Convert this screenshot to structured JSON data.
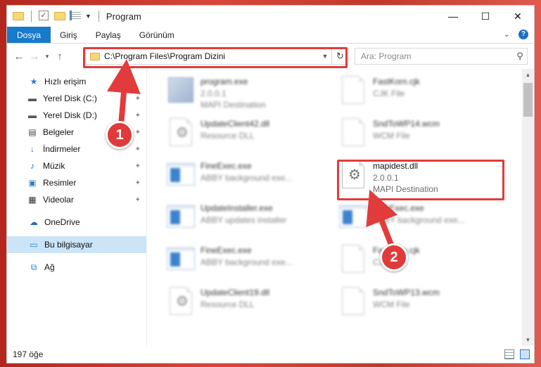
{
  "window": {
    "title": "Program",
    "controls": {
      "minimize": "—",
      "maximize": "☐",
      "close": "✕"
    }
  },
  "ribbon": {
    "tabs": [
      "Dosya",
      "Giriş",
      "Paylaş",
      "Görünüm"
    ],
    "expand_icon": "chevron-down-icon",
    "help_label": "?"
  },
  "address": {
    "path": "C:\\Program Files\\Program Dizini",
    "search_placeholder": "Ara: Program"
  },
  "sidebar": {
    "quick_access": "Hızlı erişim",
    "pinned": [
      "Yerel Disk (C:)",
      "Yerel Disk (D:)",
      "Belgeler",
      "İndirmeler",
      "Müzik",
      "Resimler",
      "Videolar"
    ],
    "onedrive": "OneDrive",
    "this_pc": "Bu bilgisayar",
    "network": "Ağ"
  },
  "files": {
    "left": [
      {
        "name": "program.exe",
        "line2": "2.0.0.1",
        "line3": "MAPI Destination",
        "icon": "exe-icon"
      },
      {
        "name": "UpdateClient42.dll",
        "line2": "Resource DLL",
        "icon": "dll-gear-icon"
      },
      {
        "name": "FineExec.exe",
        "line2": "ABBY background exe...",
        "icon": "app-window-icon"
      },
      {
        "name": "UpdateInstaller.exe",
        "line2": "ABBY updates installer",
        "icon": "app-window-icon"
      },
      {
        "name": "FineExec.exe",
        "line2": "ABBY background exe...",
        "icon": "app-window-icon"
      },
      {
        "name": "UpdateClient19.dll",
        "line2": "Resource DLL",
        "icon": "dll-gear-icon"
      }
    ],
    "right": [
      {
        "name": "FastKorn.cjk",
        "line2": "CJK File",
        "icon": "blank-file-icon"
      },
      {
        "name": "SndToWP14.wcm",
        "line2": "WCM File",
        "icon": "blank-file-icon"
      },
      {
        "name": "mapidest.dll",
        "line2": "2.0.0.1",
        "line3": "MAPI Destination",
        "icon": "dll-gear-icon",
        "highlighted": true
      },
      {
        "name": "FineExec.exe",
        "line2": "ABBY background exe...",
        "icon": "app-window-icon"
      },
      {
        "name": "FastKorn.cjk",
        "line2": "CJK File",
        "icon": "blank-file-icon"
      },
      {
        "name": "SndToWP13.wcm",
        "line2": "WCM File",
        "icon": "blank-file-icon"
      }
    ]
  },
  "status": {
    "item_count": "197 öğe"
  },
  "annotations": {
    "badge1": "1",
    "badge2": "2",
    "accent": "#e23b3b"
  }
}
